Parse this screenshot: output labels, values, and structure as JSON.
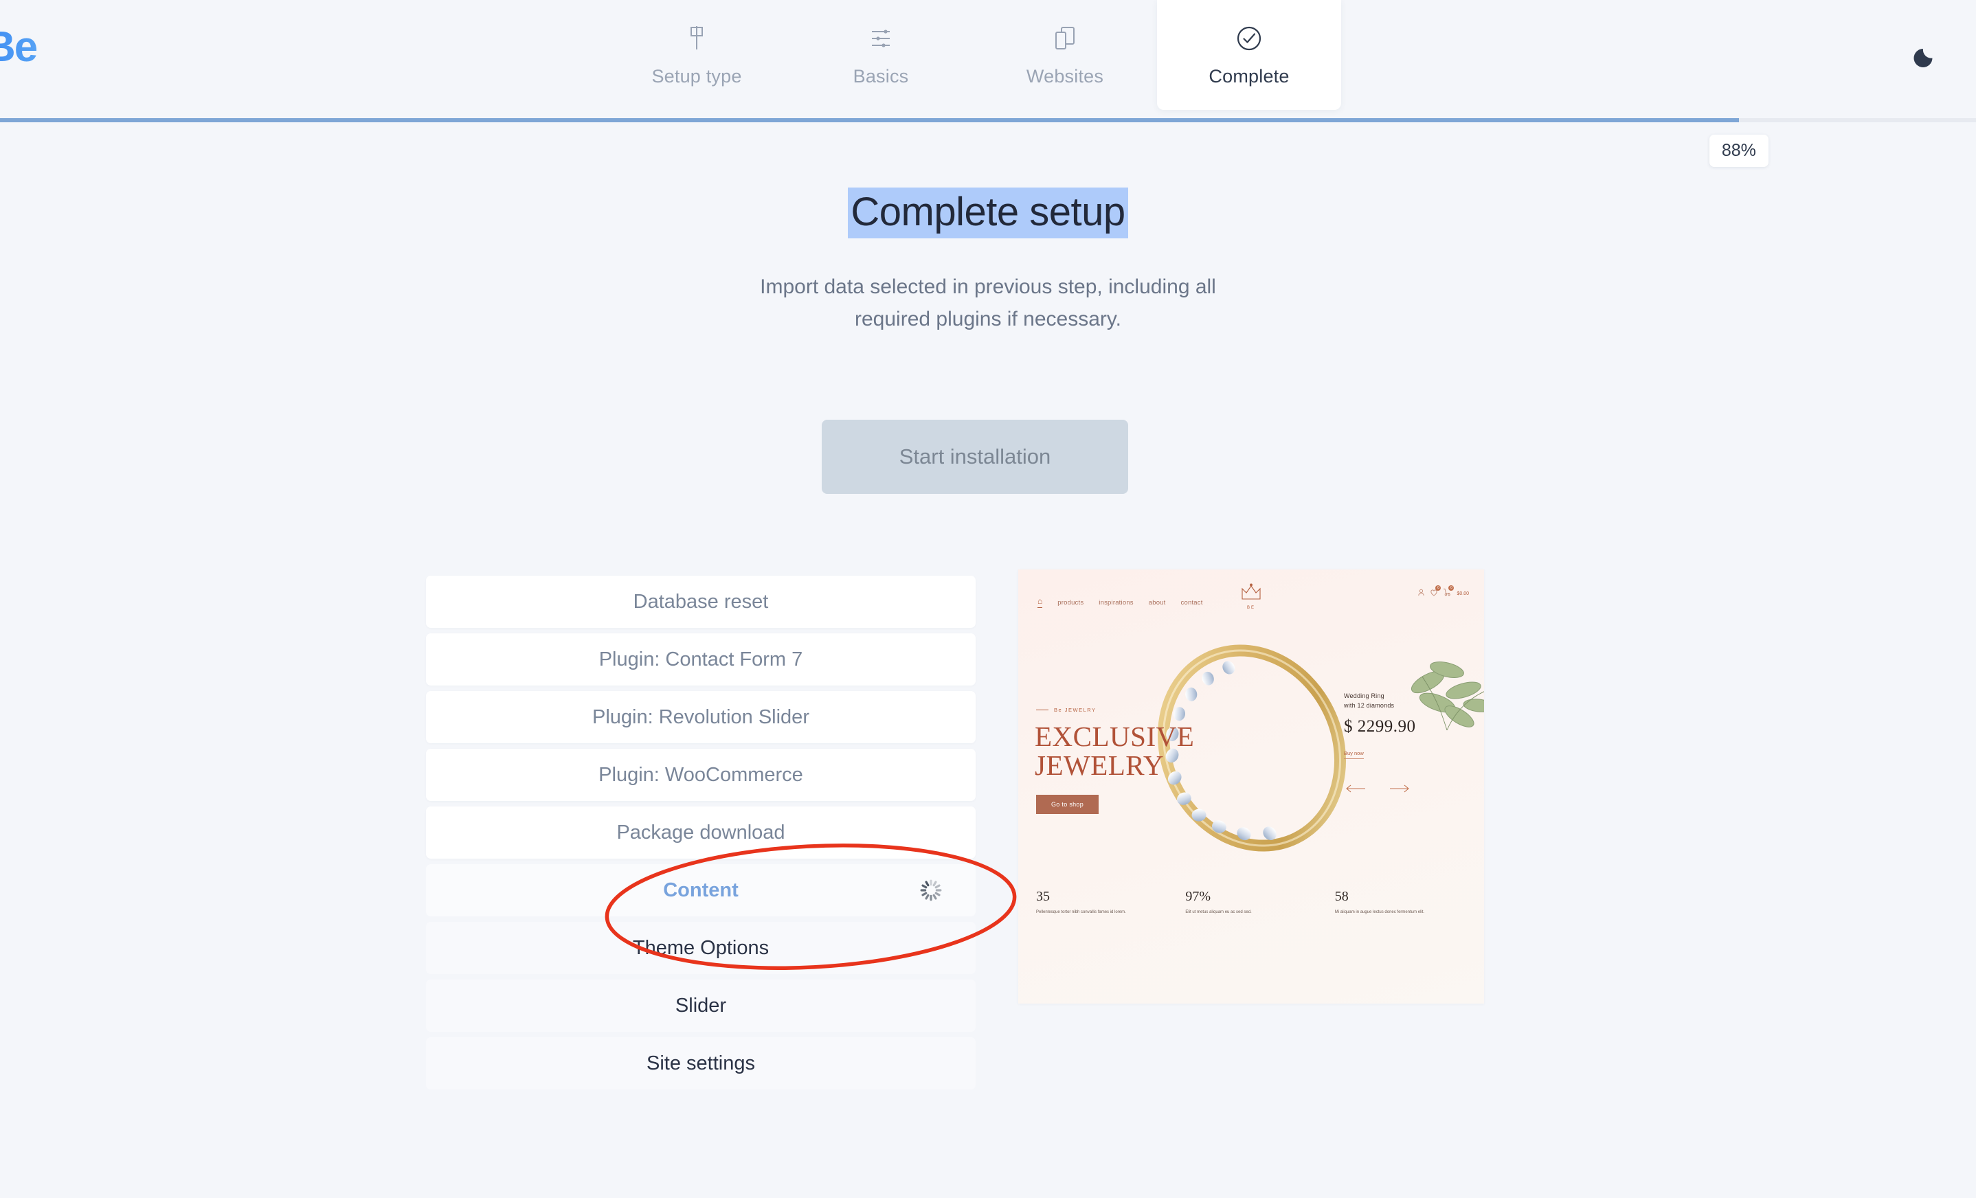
{
  "brand": {
    "logo_text": "Be",
    "logo_color": "#3d8bf2"
  },
  "theme_toggle": {
    "icon": "moon-icon",
    "mode_label": "Dark mode"
  },
  "steps": [
    {
      "label": "Setup type",
      "icon": "flag-pin-icon",
      "active": false
    },
    {
      "label": "Basics",
      "icon": "sliders-icon",
      "active": false
    },
    {
      "label": "Websites",
      "icon": "layers-copy-icon",
      "active": false
    },
    {
      "label": "Complete",
      "icon": "check-circle-icon",
      "active": true
    }
  ],
  "progress": {
    "percent": 88,
    "percent_label": "88%",
    "fill_color": "#7ea6d6",
    "track_color": "#e7eaf0"
  },
  "hero": {
    "title": "Complete setup",
    "title_selected": true,
    "subtitle_line1": "Import data selected in previous step, including all",
    "subtitle_line2": "required plugins if necessary."
  },
  "primary_button": {
    "label": "Start installation",
    "disabled": true,
    "bg": "#ced8e2",
    "fg": "#7c8794"
  },
  "tasks": [
    {
      "label": "Database reset",
      "state": "done"
    },
    {
      "label": "Plugin: Contact Form 7",
      "state": "done"
    },
    {
      "label": "Plugin: Revolution Slider",
      "state": "done"
    },
    {
      "label": "Plugin: WooCommerce",
      "state": "done"
    },
    {
      "label": "Package download",
      "state": "done"
    },
    {
      "label": "Content",
      "state": "running",
      "spinner": "loading-spinner-icon"
    },
    {
      "label": "Theme Options",
      "state": "pending"
    },
    {
      "label": "Slider",
      "state": "pending"
    },
    {
      "label": "Site settings",
      "state": "pending"
    }
  ],
  "preview": {
    "nav": {
      "home_icon": "home-icon",
      "items": [
        "products",
        "inspirations",
        "about",
        "contact"
      ]
    },
    "logo": {
      "icon": "crown-icon",
      "name": "BE"
    },
    "utility": {
      "account_icon": "user-icon",
      "wishlist_icon": "heart-icon",
      "wishlist_count": "0",
      "cart_icon": "cart-icon",
      "cart_count": "0",
      "cart_total": "$0.00"
    },
    "eyebrow": "Be JEWELRY",
    "title_line1": "EXCLUSIVE",
    "title_line2": "JEWELRY",
    "cta": "Go to shop",
    "product": {
      "name_line1": "Wedding Ring",
      "name_line2": "with 12 diamonds",
      "price": "$ 2299.90",
      "buy_link": "Buy now"
    },
    "carousel": {
      "prev_icon": "arrow-left-icon",
      "next_icon": "arrow-right-icon"
    },
    "stats": [
      {
        "number": "35",
        "caption": "Pellentesque tortor nibh convallis fames id lorem."
      },
      {
        "number": "97%",
        "caption": "Elit ut metus aliquam eu ac sed sed."
      },
      {
        "number": "58",
        "caption": "Mi aliquam in augue lectus donec fermentum elit."
      }
    ]
  },
  "annotation": {
    "shape": "ellipse",
    "color": "#e8341c",
    "targets": [
      "Content",
      "Theme Options"
    ]
  }
}
